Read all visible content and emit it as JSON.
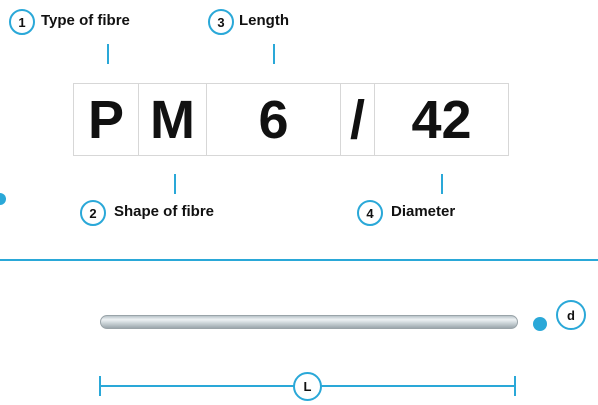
{
  "callouts": {
    "type": {
      "num": "1",
      "label": "Type of fibre"
    },
    "shape": {
      "num": "2",
      "label": "Shape of fibre"
    },
    "length": {
      "num": "3",
      "label": "Length"
    },
    "diameter": {
      "num": "4",
      "label": "Diameter"
    }
  },
  "code": [
    "P",
    "M",
    "6",
    "/",
    "42"
  ],
  "dimensions": {
    "diameter_symbol": "d",
    "length_symbol": "L"
  },
  "colors": {
    "accent": "#2aa8d8",
    "border": "#d7d7d7",
    "text": "#111111"
  }
}
